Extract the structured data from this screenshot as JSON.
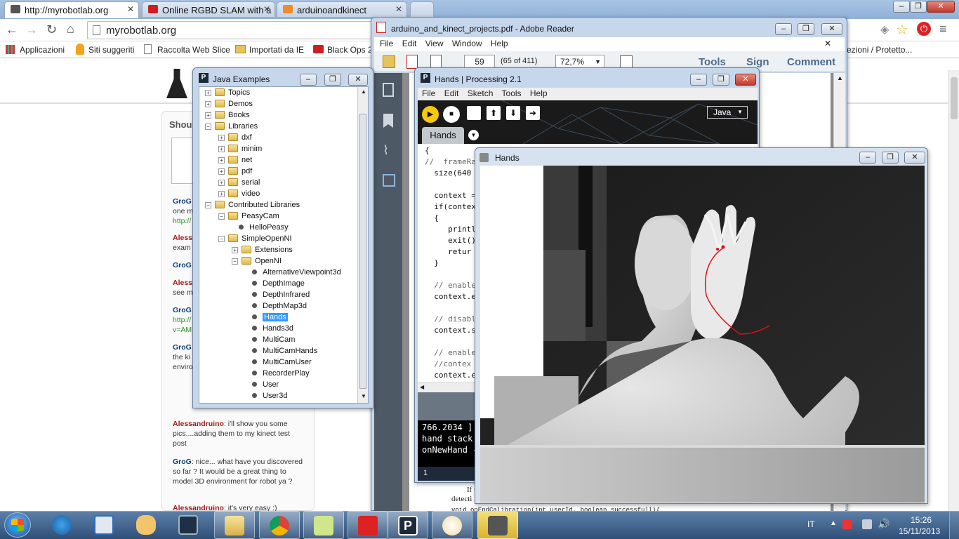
{
  "browser": {
    "tabs": [
      {
        "label": "http://myrobotlab.org",
        "favicon": "#6a6a6a"
      },
      {
        "label": "Online RGBD SLAM with a",
        "favicon": "#cc1f1f"
      },
      {
        "label": "arduinoandkinect",
        "favicon": "#f08a2e"
      }
    ],
    "address": "myrobotlab.org",
    "bookmarks": [
      "Applicazioni",
      "Siti suggeriti",
      "Raccolta Web Slice",
      "Importati da IE",
      "Black Ops 2",
      "ezioni / Protetto..."
    ],
    "page_heading": "Shou",
    "comments": [
      {
        "user": "GroG",
        "text": "one m",
        "link": "http://"
      },
      {
        "user": "Aless",
        "text": "exam"
      },
      {
        "user": "GroG",
        "text": ""
      },
      {
        "user": "Aless",
        "text": "see m"
      },
      {
        "user": "GroG",
        "text": "http://",
        "link": "v=AM"
      },
      {
        "user": "GroG",
        "text": "the ki spaci is a lit headi to do a larger environment"
      },
      {
        "user": "Alessandruino",
        "text": ": i'll show you some pics....adding them to my kinect test post"
      },
      {
        "user": "GroG",
        "text": ": nice... what have you discovered so far ? It would be a great thing to model 3D environment for robot ya ?"
      },
      {
        "user": "Alessandruino",
        "text": ": it's very easy :)"
      }
    ]
  },
  "adobe": {
    "title": "arduino_and_kinect_projects.pdf - Adobe Reader",
    "menu": [
      "File",
      "Edit",
      "View",
      "Window",
      "Help"
    ],
    "page": "59",
    "page_count": "(65 of 411)",
    "zoom": "72,7%",
    "tools": "Tools",
    "sign": "Sign",
    "comment": "Comment",
    "doc_text_1": "If t",
    "doc_text_2": "detecti",
    "doc_code": "void onEndCalibration(int userId, boolean successfull){"
  },
  "java_examples": {
    "title": "Java Examples",
    "tree": [
      {
        "label": "Topics",
        "depth": 0,
        "kind": "folder",
        "toggle": "+"
      },
      {
        "label": "Demos",
        "depth": 0,
        "kind": "folder",
        "toggle": "+"
      },
      {
        "label": "Books",
        "depth": 0,
        "kind": "folder",
        "toggle": "+"
      },
      {
        "label": "Libraries",
        "depth": 0,
        "kind": "folder",
        "toggle": "-"
      },
      {
        "label": "dxf",
        "depth": 1,
        "kind": "folder",
        "toggle": "+"
      },
      {
        "label": "minim",
        "depth": 1,
        "kind": "folder",
        "toggle": "+"
      },
      {
        "label": "net",
        "depth": 1,
        "kind": "folder",
        "toggle": "+"
      },
      {
        "label": "pdf",
        "depth": 1,
        "kind": "folder",
        "toggle": "+"
      },
      {
        "label": "serial",
        "depth": 1,
        "kind": "folder",
        "toggle": "+"
      },
      {
        "label": "video",
        "depth": 1,
        "kind": "folder",
        "toggle": "+"
      },
      {
        "label": "Contributed Libraries",
        "depth": 0,
        "kind": "folder",
        "toggle": "-"
      },
      {
        "label": "PeasyCam",
        "depth": 1,
        "kind": "folder",
        "toggle": "-"
      },
      {
        "label": "HelloPeasy",
        "depth": 2,
        "kind": "sketch",
        "toggle": ""
      },
      {
        "label": "SimpleOpenNI",
        "depth": 1,
        "kind": "folder",
        "toggle": "-"
      },
      {
        "label": "Extensions",
        "depth": 2,
        "kind": "folder",
        "toggle": "+"
      },
      {
        "label": "OpenNI",
        "depth": 2,
        "kind": "folder",
        "toggle": "-"
      },
      {
        "label": "AlternativeViewpoint3d",
        "depth": 3,
        "kind": "sketch",
        "toggle": ""
      },
      {
        "label": "DepthImage",
        "depth": 3,
        "kind": "sketch",
        "toggle": ""
      },
      {
        "label": "DepthInfrared",
        "depth": 3,
        "kind": "sketch",
        "toggle": ""
      },
      {
        "label": "DepthMap3d",
        "depth": 3,
        "kind": "sketch",
        "toggle": ""
      },
      {
        "label": "Hands",
        "depth": 3,
        "kind": "sketch",
        "toggle": "",
        "selected": true
      },
      {
        "label": "Hands3d",
        "depth": 3,
        "kind": "sketch",
        "toggle": ""
      },
      {
        "label": "MultiCam",
        "depth": 3,
        "kind": "sketch",
        "toggle": ""
      },
      {
        "label": "MultiCamHands",
        "depth": 3,
        "kind": "sketch",
        "toggle": ""
      },
      {
        "label": "MultiCamUser",
        "depth": 3,
        "kind": "sketch",
        "toggle": ""
      },
      {
        "label": "RecorderPlay",
        "depth": 3,
        "kind": "sketch",
        "toggle": ""
      },
      {
        "label": "User",
        "depth": 3,
        "kind": "sketch",
        "toggle": ""
      },
      {
        "label": "User3d",
        "depth": 3,
        "kind": "sketch",
        "toggle": ""
      }
    ]
  },
  "processing": {
    "title": "Hands | Processing 2.1",
    "menu": [
      "File",
      "Edit",
      "Sketch",
      "Tools",
      "Help"
    ],
    "mode": "Java",
    "tab": "Hands",
    "code": [
      "{",
      "//  frameRa",
      "  size(640",
      "",
      "  context =",
      "  if(contex",
      "  {",
      "     printl",
      "     exit()",
      "     retur",
      "  }",
      "",
      "  // enable",
      "  context.e",
      "",
      "  // disabl",
      "  context.s",
      "",
      "  // enable",
      "  //contex",
      "  context.e"
    ],
    "console": [
      "766.2034 ]",
      "hand stack",
      "onNewHand -"
    ],
    "line_number": "1"
  },
  "hands_window": {
    "title": "Hands"
  },
  "taskbar": {
    "lang": "IT",
    "time": "15:26",
    "date": "15/11/2013"
  }
}
